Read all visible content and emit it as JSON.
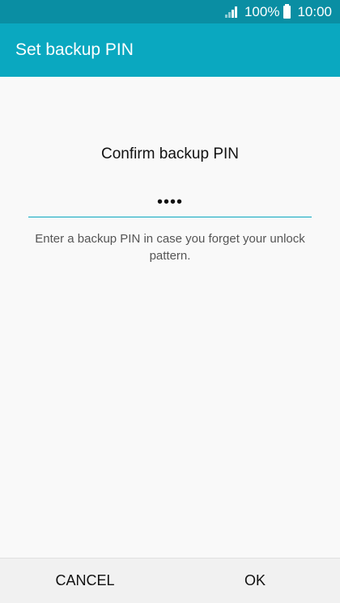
{
  "status_bar": {
    "battery": "100%",
    "time": "10:00",
    "signal_icon": "signal-bars-icon",
    "battery_icon": "battery-icon"
  },
  "app_bar": {
    "title": "Set backup PIN"
  },
  "main": {
    "heading": "Confirm backup PIN",
    "pin_value": "••••",
    "helper_text": "Enter a backup PIN in case you forget your unlock pattern."
  },
  "actions": {
    "cancel_label": "CANCEL",
    "ok_label": "OK"
  },
  "colors": {
    "status_bar": "#0a8ea3",
    "app_bar": "#0aa8c0",
    "accent": "#0aa8c0"
  }
}
